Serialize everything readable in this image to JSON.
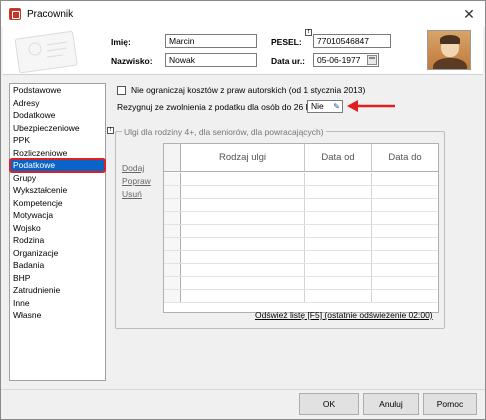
{
  "window": {
    "title": "Pracownik",
    "close_glyph": "✕",
    "icon": "app-icon"
  },
  "header": {
    "first_name_label": "Imię:",
    "first_name_value": "Marcin",
    "last_name_label": "Nazwisko:",
    "last_name_value": "Nowak",
    "pesel_label": "PESEL:",
    "pesel_value": "77010546847",
    "birth_date_label": "Data ur.:",
    "birth_date_value": "05-06-1977",
    "info_glyph": "!"
  },
  "sidebar": {
    "items": [
      {
        "label": "Podstawowe"
      },
      {
        "label": "Adresy"
      },
      {
        "label": "Dodatkowe"
      },
      {
        "label": "Ubezpieczeniowe"
      },
      {
        "label": "PPK"
      },
      {
        "label": "Rozliczeniowe"
      },
      {
        "label": "Podatkowe",
        "active": true
      },
      {
        "label": "Grupy"
      },
      {
        "label": "Wykształcenie"
      },
      {
        "label": "Kompetencje"
      },
      {
        "label": "Motywacja"
      },
      {
        "label": "Wojsko"
      },
      {
        "label": "Rodzina"
      },
      {
        "label": "Organizacje"
      },
      {
        "label": "Badania"
      },
      {
        "label": "BHP"
      },
      {
        "label": "Zatrudnienie"
      },
      {
        "label": "Inne"
      },
      {
        "label": "Własne"
      }
    ]
  },
  "main": {
    "checkbox_label": "Nie ograniczaj kosztów z praw autorskich (od 1 stycznia 2013)",
    "checkbox_checked": false,
    "exemption_label": "Rezygnuj ze zwolnienia z podatku dla osób do 26 lat:",
    "exemption_value": "Nie",
    "group_title": "Ulgi dla rodziny 4+, dla seniorów, dla powracających)",
    "actions": {
      "add": "Dodaj",
      "edit": "Popraw",
      "delete": "Usuń"
    },
    "columns": [
      "Rodzaj ulgi",
      "Data od",
      "Data do"
    ],
    "refresh_link": "Odśwież listę [F5] (ostatnie odświeżenie 02:00)"
  },
  "buttons": {
    "ok": "OK",
    "cancel": "Anuluj",
    "help": "Pomoc"
  },
  "colors": {
    "active_item": "#0a64c8",
    "highlight": "#e02020"
  }
}
